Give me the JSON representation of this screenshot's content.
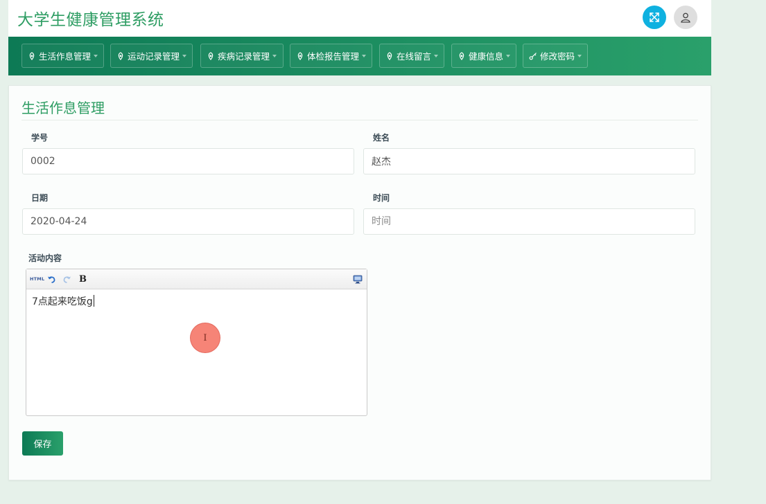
{
  "app": {
    "title": "大学生健康管理系统"
  },
  "header": {
    "fullscreen_icon": "expand-arrows-icon",
    "user_icon": "user-icon"
  },
  "nav": {
    "items": [
      {
        "label": "生活作息管理"
      },
      {
        "label": "运动记录管理"
      },
      {
        "label": "疾病记录管理"
      },
      {
        "label": "体检报告管理"
      },
      {
        "label": "在线留言"
      },
      {
        "label": "健康信息"
      },
      {
        "label": "修改密码"
      }
    ]
  },
  "form": {
    "title": "生活作息管理",
    "student_id": {
      "label": "学号",
      "value": "0002"
    },
    "name": {
      "label": "姓名",
      "value": "赵杰"
    },
    "date": {
      "label": "日期",
      "value": "2020-04-24"
    },
    "time": {
      "label": "时间",
      "value": "",
      "placeholder": "时间"
    },
    "activity": {
      "label": "活动内容",
      "toolbar": {
        "html_label": "HTML",
        "bold_label": "B"
      },
      "content": "7点起来吃饭g"
    },
    "save_label": "保存"
  },
  "colors": {
    "brand": "#2e9d63",
    "nav_start": "#0d7a55",
    "nav_end": "#2aa06b",
    "fullscreen_button": "#0fb1e0"
  }
}
